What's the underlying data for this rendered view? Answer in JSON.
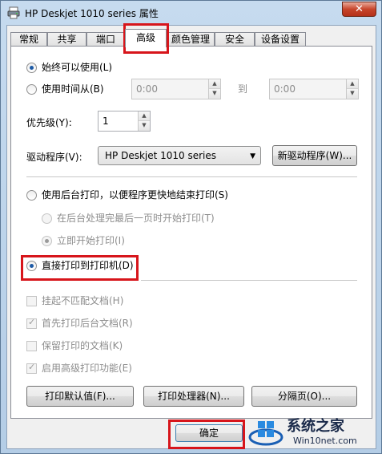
{
  "window": {
    "title": "HP Deskjet 1010 series 属性",
    "close_label": "✕"
  },
  "tabs": [
    {
      "label": "常规"
    },
    {
      "label": "共享"
    },
    {
      "label": "端口"
    },
    {
      "label": "高级"
    },
    {
      "label": "颜色管理"
    },
    {
      "label": "安全"
    },
    {
      "label": "设备设置"
    }
  ],
  "active_tab": "高级",
  "availability": {
    "always_label": "始终可以使用(L)",
    "always_checked": true,
    "time_label": "使用时间从(B)",
    "from_value": "0:00",
    "to_label": "到",
    "to_value": "0:00"
  },
  "priority": {
    "label": "优先级(Y):",
    "value": "1"
  },
  "driver": {
    "label": "驱动程序(V):",
    "value": "HP Deskjet 1010 series",
    "new_button": "新驱动程序(W)..."
  },
  "spooling": {
    "spool_label": "使用后台打印，以便程序更快地结束打印(S)",
    "after_last_label": "在后台处理完最后一页时开始打印(T)",
    "immediately_label": "立即开始打印(I)",
    "direct_label": "直接打印到打印机(D)",
    "direct_checked": true
  },
  "options": [
    {
      "label": "挂起不匹配文档(H)",
      "checked": false
    },
    {
      "label": "首先打印后台文档(R)",
      "checked": true
    },
    {
      "label": "保留打印的文档(K)",
      "checked": false
    },
    {
      "label": "启用高级打印功能(E)",
      "checked": true
    }
  ],
  "buttons": {
    "defaults": "打印默认值(F)...",
    "processor": "打印处理器(N)...",
    "separator": "分隔页(O)...",
    "ok": "确定"
  },
  "watermark": {
    "title": "系统之家",
    "subtitle": "Win10net.com"
  },
  "colors": {
    "highlight": "#d7151b",
    "accent": "#1d5aa5"
  }
}
